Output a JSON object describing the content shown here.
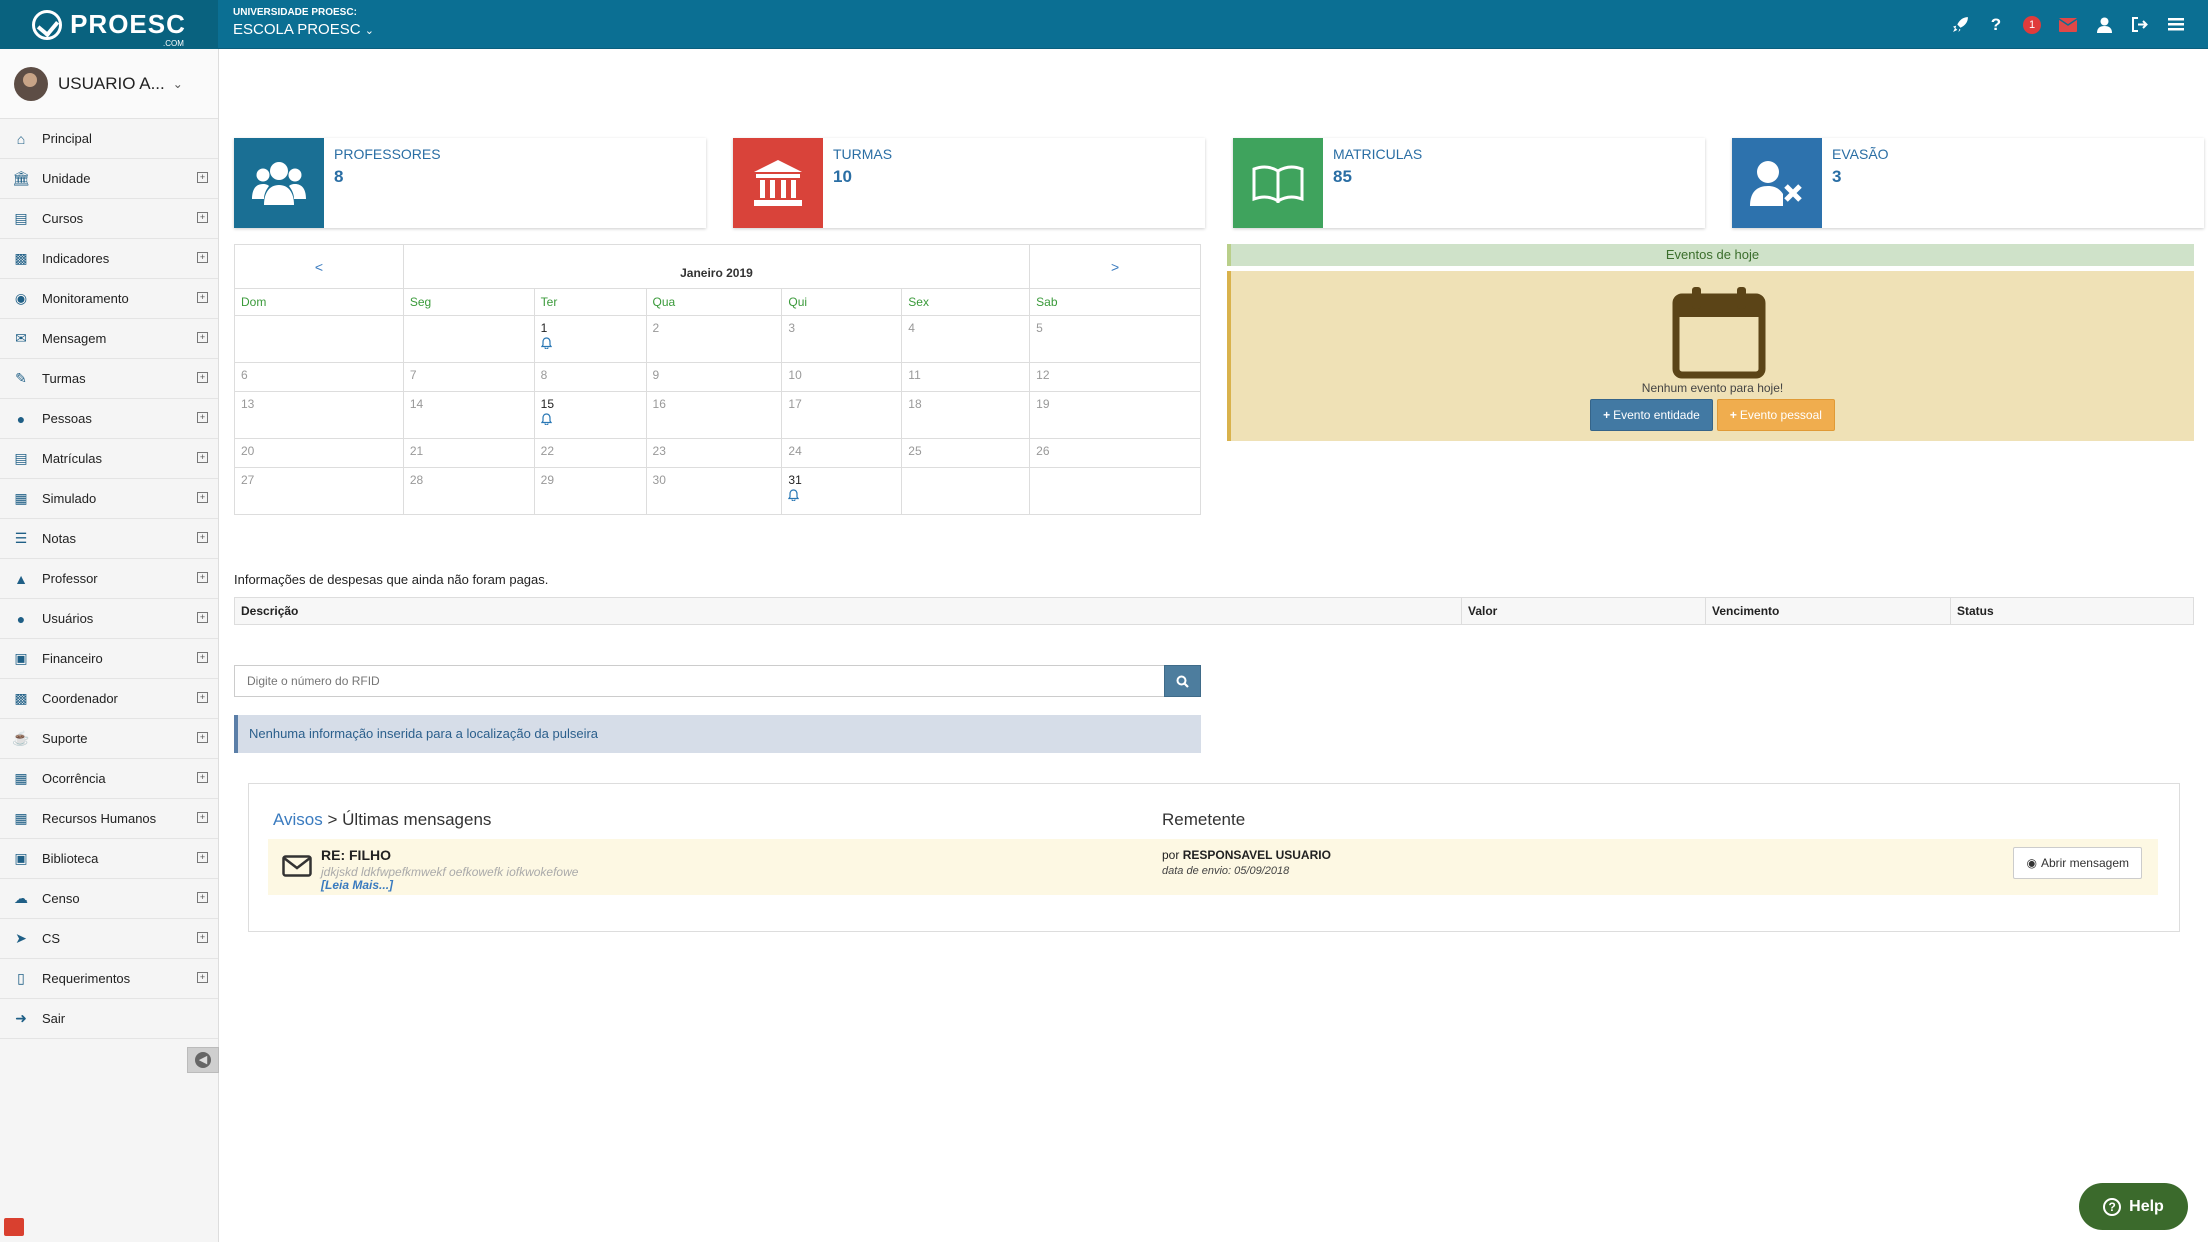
{
  "header": {
    "brand": "PROESC",
    "brand_sub": ".COM",
    "university_label": "UNIVERSIDADE PROESC:",
    "school": "ESCOLA PROESC",
    "notification_count": "1"
  },
  "sidebar": {
    "user_name": "USUARIO A...",
    "items": [
      {
        "label": "Principal",
        "icon": "home-icon",
        "expandable": false
      },
      {
        "label": "Unidade",
        "icon": "bank-icon",
        "expandable": true
      },
      {
        "label": "Cursos",
        "icon": "book-icon",
        "expandable": true
      },
      {
        "label": "Indicadores",
        "icon": "bar-chart-icon",
        "expandable": true
      },
      {
        "label": "Monitoramento",
        "icon": "eye-icon",
        "expandable": true
      },
      {
        "label": "Mensagem",
        "icon": "envelope-icon",
        "expandable": true
      },
      {
        "label": "Turmas",
        "icon": "pencil-icon",
        "expandable": true
      },
      {
        "label": "Pessoas",
        "icon": "users-icon",
        "expandable": true
      },
      {
        "label": "Matrículas",
        "icon": "open-book-icon",
        "expandable": true
      },
      {
        "label": "Simulado",
        "icon": "puzzle-icon",
        "expandable": true
      },
      {
        "label": "Notas",
        "icon": "list-icon",
        "expandable": true
      },
      {
        "label": "Professor",
        "icon": "graduation-cap-icon",
        "expandable": true
      },
      {
        "label": "Usuários",
        "icon": "user-icon",
        "expandable": true
      },
      {
        "label": "Financeiro",
        "icon": "money-icon",
        "expandable": true
      },
      {
        "label": "Coordenador",
        "icon": "bar-chart-icon",
        "expandable": true
      },
      {
        "label": "Suporte",
        "icon": "coffee-icon",
        "expandable": true
      },
      {
        "label": "Ocorrência",
        "icon": "calendar-icon",
        "expandable": true
      },
      {
        "label": "Recursos Humanos",
        "icon": "grid-icon",
        "expandable": true
      },
      {
        "label": "Biblioteca",
        "icon": "archive-icon",
        "expandable": true
      },
      {
        "label": "Censo",
        "icon": "cloud-download-icon",
        "expandable": true
      },
      {
        "label": "CS",
        "icon": "rocket-icon",
        "expandable": true
      },
      {
        "label": "Requerimentos",
        "icon": "folder-open-icon",
        "expandable": true
      },
      {
        "label": "Sair",
        "icon": "sign-out-icon",
        "expandable": false
      }
    ]
  },
  "stats": [
    {
      "title": "PROFESSORES",
      "value": "8",
      "color": "#1a6f94",
      "icon": "users-icon"
    },
    {
      "title": "TURMAS",
      "value": "10",
      "color": "#d9433a",
      "icon": "bank-icon"
    },
    {
      "title": "MATRICULAS",
      "value": "85",
      "color": "#3fa35d",
      "icon": "open-book-icon"
    },
    {
      "title": "EVASÃO",
      "value": "3",
      "color": "#2d72ad",
      "icon": "user-times-icon"
    }
  ],
  "calendar": {
    "prev": "<",
    "next": ">",
    "month": "Janeiro 2019",
    "weekdays": [
      "Dom",
      "Seg",
      "Ter",
      "Qua",
      "Qui",
      "Sex",
      "Sab"
    ],
    "weeks": [
      [
        {
          "d": ""
        },
        {
          "d": ""
        },
        {
          "d": "1",
          "event": true
        },
        {
          "d": "2"
        },
        {
          "d": "3"
        },
        {
          "d": "4"
        },
        {
          "d": "5"
        }
      ],
      [
        {
          "d": "6"
        },
        {
          "d": "7"
        },
        {
          "d": "8"
        },
        {
          "d": "9"
        },
        {
          "d": "10"
        },
        {
          "d": "11"
        },
        {
          "d": "12"
        }
      ],
      [
        {
          "d": "13"
        },
        {
          "d": "14"
        },
        {
          "d": "15",
          "event": true
        },
        {
          "d": "16"
        },
        {
          "d": "17"
        },
        {
          "d": "18"
        },
        {
          "d": "19"
        }
      ],
      [
        {
          "d": "20"
        },
        {
          "d": "21"
        },
        {
          "d": "22"
        },
        {
          "d": "23"
        },
        {
          "d": "24"
        },
        {
          "d": "25"
        },
        {
          "d": "26"
        }
      ],
      [
        {
          "d": "27"
        },
        {
          "d": "28"
        },
        {
          "d": "29"
        },
        {
          "d": "30"
        },
        {
          "d": "31",
          "event": true
        },
        {
          "d": ""
        },
        {
          "d": ""
        }
      ]
    ]
  },
  "events": {
    "title": "Eventos de hoje",
    "empty": "Nenhum evento para hoje!",
    "btn_entity": "Evento entidade",
    "btn_personal": "Evento pessoal"
  },
  "despesas": {
    "info": "Informações de despesas que ainda não foram pagas.",
    "columns": [
      "Descrição",
      "Valor",
      "Vencimento",
      "Status"
    ]
  },
  "rfid": {
    "placeholder": "Digite o número do RFID",
    "info": "Nenhuma informação inserida para a localização da pulseira"
  },
  "avisos": {
    "link": "Avisos",
    "separator": " > ",
    "title": "Últimas mensagens",
    "sender_header": "Remetente",
    "message": {
      "subject": "RE: FILHO",
      "preview": "jdkjskd ldkfwpefkmwekf oefkowefk iofkwokefowe",
      "read_more": "[Leia Mais...]",
      "por": "por",
      "sender": "RESPONSAVEL USUARIO",
      "date": "data de envio: 05/09/2018",
      "open_label": "Abrir mensagem"
    }
  },
  "help": {
    "label": "Help"
  }
}
